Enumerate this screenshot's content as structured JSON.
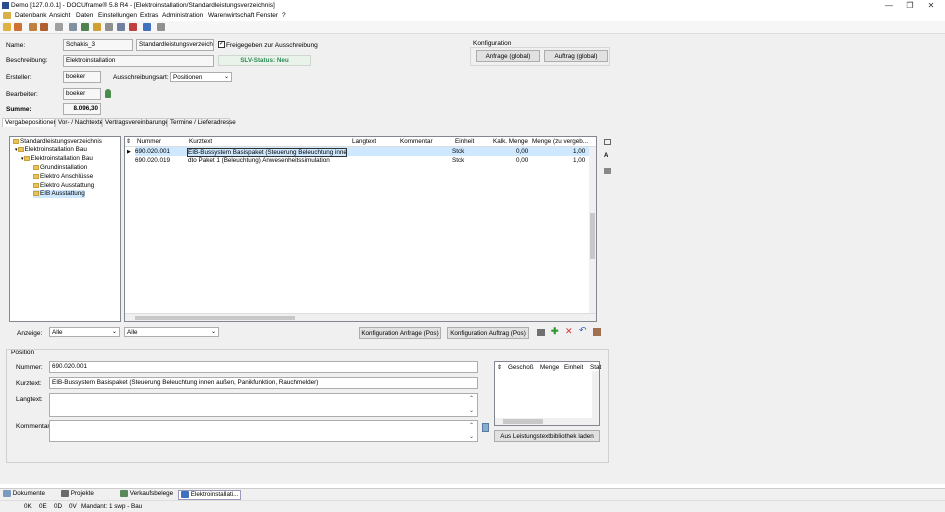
{
  "window": {
    "title": "Demo [127.0.0.1] - DOCUframe® 5.8 R4 - [Elektroinstallation/Standardleistungsverzeichnis]",
    "minimize": "—",
    "restore": "❐",
    "close": "✕"
  },
  "menu": [
    "Datenbank",
    "Ansicht",
    "Daten",
    "Einstellungen",
    "Extras",
    "Administration",
    "Warenwirtschaft",
    "Fenster",
    "?"
  ],
  "header": {
    "name_label": "Name:",
    "name_value": "Schakis_3",
    "type_value": "Standardleistungsverzeichnis",
    "published_label": "Freigegeben zur Ausschreibung",
    "published_checked": true,
    "description_label": "Beschreibung:",
    "description_value": "Elektroinstallation",
    "status_text": "SLV-Status: Neu",
    "creator_label": "Ersteller:",
    "creator_value": "boeker",
    "tender_type_label": "Ausschreibungsart:",
    "tender_type_value": "Positionen",
    "editor_label": "Bearbeiter:",
    "editor_value": "boeker",
    "sum_label": "Summe:",
    "sum_value": "8.096,30"
  },
  "config": {
    "title": "Konfiguration",
    "request_button": "Anfrage (global)",
    "order_button": "Auftrag (global)"
  },
  "tabs": [
    "Vergabepositionen",
    "Vor- / Nachtexte",
    "Vertragsvereinbarungen",
    "Termine / Lieferadresse"
  ],
  "tree": {
    "root": "Standardleistungsverzeichnis",
    "l1": "Elektroinstallation Bau",
    "l2": "Elektroinstallation Bau",
    "children": [
      "Grundinstallation",
      "Elektro Anschlüsse",
      "Elektro Ausstattung",
      "EIB Ausstattung"
    ]
  },
  "grid": {
    "columns": [
      "Nummer",
      "Kurztext",
      "Langtext",
      "Kommentar",
      "Einheit",
      "Kalk. Menge",
      "Menge (zu vergeb..."
    ],
    "rows": [
      {
        "number": "690.020.001",
        "short": "EIB-Bussystem Basispaket (Steuerung Beleuchtung innen auße",
        "long": "",
        "comment": "",
        "unit": "Stck",
        "calc_qty": "0,00",
        "qty": "1,00"
      },
      {
        "number": "690.020.019",
        "short": "dto Paket 1 (Beleuchtung) Anwesenheitssimulation",
        "long": "",
        "comment": "",
        "unit": "Stck",
        "calc_qty": "0,00",
        "qty": "1,00"
      }
    ]
  },
  "filters": {
    "display_label": "Anzeige:",
    "filter1": "Alle",
    "filter2": "Alle",
    "config_request_pos": "Konfiguration Anfrage (Pos)",
    "config_order_pos": "Konfiguration Auftrag (Pos)"
  },
  "position": {
    "title": "Position",
    "number_label": "Nummer:",
    "number_value": "690.020.001",
    "short_label": "Kurztext:",
    "short_value": "EIB-Bussystem Basispaket (Steuerung Beleuchtung innen außen, Panikfunktion, Rauchmelder)",
    "long_label": "Langtext:",
    "long_value": "",
    "comment_label": "Kommentar:",
    "comment_value": "",
    "subgrid_columns": [
      "Geschoß",
      "Menge",
      "Einheit",
      "Stat"
    ],
    "library_button": "Aus Leistungstextbibliothek laden"
  },
  "taskbar": [
    "Dokumente",
    "Projekte",
    "Verkaufsbelege",
    "Elektroinstallati..."
  ],
  "statusbar": [
    "0K",
    "0E",
    "0D",
    "0V",
    "Mandant: 1 swp - Bau"
  ],
  "colors": {
    "status_green": "#2e8b57",
    "selection": "#cde8ff",
    "folder": "#e8c25a"
  }
}
